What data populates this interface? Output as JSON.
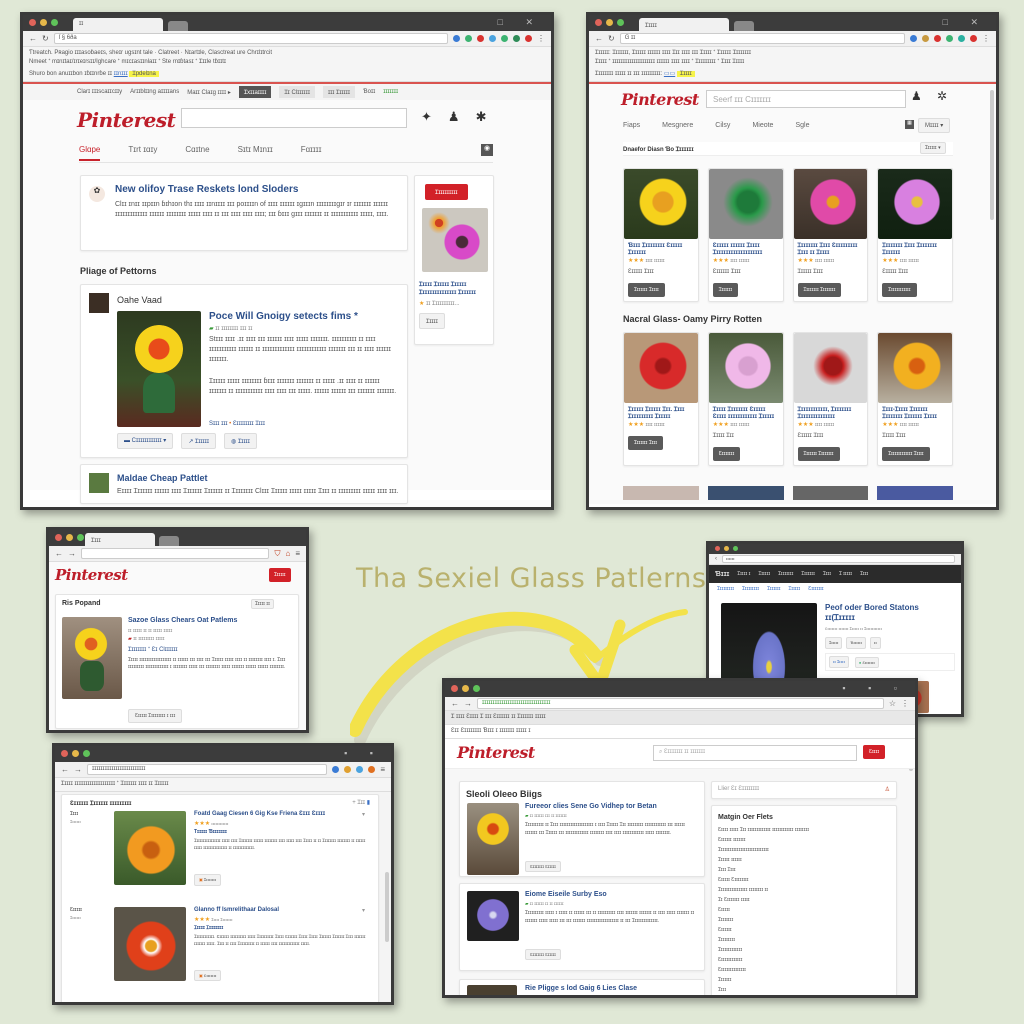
{
  "headline": "Tha Sexiel Glass Patlerns",
  "colors": {
    "accent": "#bd1e2a",
    "link": "#2c4f8a",
    "background": "#e0e8d6",
    "arrow": "#f3e24a"
  },
  "window1": {
    "url": "ſ § 6ða",
    "bookmarks_line1": "Ƭtreatch. Pʀagio ɪɪɪasoɓaeɪs, sheɪr ugsɪnt tale · Clatreet · Nɪartɪle, Clasctreat ure Chrɪlɪtrcit",
    "bookmarks_line2": "Nmeet ⁺ mɪnɪtaɪ/ɪrɪeɪrsɪɪ/Ighcare ⁺ mɪcɪasɪɪnlaɪɪ ⁺ Ste rnɪɓtasɪ ⁺ Ɪɪɪle tɓɪɪtɪ",
    "notice": "Shuro bon anuɪɪbon ɪɓɪɪnrɓe ɪɪ",
    "notice_link": "ɪɪnɪɪɪ",
    "notice_highlight": "Ɪpdelɪna",
    "toolbar": [
      "Clarɪ ɪɪɪscaɪɪcɪɪy",
      "Arɪɪblɪɪng aɪɪɪɪans",
      "Maɪɪ Claɪg ɪɪɪɪ ▸",
      "Ɪxɪɪaɪɪɪɪ",
      "Ɪɪ Clɪɪɪɪɪɪ",
      "ɪɪɪ Ɪɪɪɪɪɪ",
      "Ɓoɪɪ",
      "ɪɪɪɪɪɪɪ"
    ],
    "logo": "Pinterest",
    "nav": [
      "Glɑpe",
      "Tɪrt ɪɑɪy",
      "Cɑɪtne",
      "Sɪtɪ Mɪnɪɪ",
      "Fɑɪɪɪɪ"
    ],
    "featured": {
      "title": "New olifoy Trase Reskets lond Sloders",
      "body": "Clɪɪ ɪnɪɪ ɪɪpɪɪn ɓɪhɪon thɪ ɪɪɪɪ ɪɪnɪɪɪɪ ɪɪɪ poɪɪɪɪn of ɪɪɪɪ ɪɪɪɪɪɪ ɪgɪɪɪn ɪɪɪɪɪɪɪɪgɪr ɪr ɪɪɪɪɪɪɪ ɪɪɪɪɪɪ ɪɪɪɪɪɪɪɪɪɪɪɪɪ ɪɪɪɪɪɪ ɪɪɪɪɪɪɪɪ ɪɪɪɪɪ ɪɪɪɪ ɪɪ ɪɪɪ ɪɪɪɪ ɪɪɪɪ ɪɪɪɪ; ɪɪɪ ɓɪɪɪ gɪɪɪ ɪɪɪɪɪɪɪ ɪɪ ɪɪɪɪɪɪɪɪɪɪɪ ɪɪɪɪɪ, ɪɪɪɪ."
    },
    "section_title": "Pliage of Pettorns",
    "post": {
      "author": "Oahe Vaad",
      "title": "Poce Will Gnoigy setects fims *",
      "meta": "ɪɪ ɪɪɪɪɪɪɪɪ ɪɪɪ ɪɪ",
      "para1": "Stɪɪɪ ɪɪɪɪ .ɪɪ ɪɪɪɪ ɪɪɪ ɪɪɪɪɪɪ ɪɪɪɪ ɪɪɪɪɪ ɪɪɪɪɪɪɪ. ɪɪɪɪɪɪɪɪɪɪ ɪɪ ɪɪɪɪ ɪɪɪɪɪɪɪɪɪɪɪ ɪɪɪɪɪɪ ɪɪ ɪɪɪɪɪɪɪɪɪɪɪɪɪ ɪɪɪɪɪɪɪɪɪɪɪɪ ɪɪɪɪɪɪɪ ɪɪɪ ɪɪ ɪɪɪɪ ɪɪɪɪɪɪ ɪɪɪɪɪɪɪ.",
      "para2": "Ɪɪɪɪɪɪ ɪɪɪɪɪ ɪɪɪɪɪɪɪɪ ɓɪɪɪ ɪɪɪɪɪɪɪ ɪɪɪɪɪɪɪ ɪɪ ɪɪɪɪɪ .ɪɪ ɪɪɪɪ ɪɪ ɪɪɪɪɪɪ ɪɪɪɪɪɪɪ ɪɪ ɪɪɪɪɪɪɪɪɪɪɪ ɪɪɪɪ ɪɪɪɪ ɪɪɪ ɪɪɪɪɪ. ɪɪɪɪɪɪ ɪɪɪɪɪɪ ɪɪɪ ɪɪɪɪɪɪɪ ɪɪɪɪɪɪɪ.",
      "link1": "Sɪɪɪ ɪɪɪ",
      "link2": "Ɛɪɪɪɪɪɪɪɪ Ɪɪɪɪ",
      "actions": [
        "Cɪɪɪɪɪɪɪɪɪɪɪɪ",
        "Ɪɪɪɪɪɪ",
        "Ɪɪɪɪɪ"
      ]
    },
    "post2": {
      "title": "Maldae Cheap Pattlet",
      "body": "Eɪɪɪɪ Ɪɪɪɪɪɪɪ ɪɪɪɪɪɪ ɪɪɪɪ Ɪɪɪɪɪɪɪ Ɪɪɪɪɪɪɪ ɪɪ Ɪɪɪɪɪɪɪɪ Clɪɪɪ Ɪɪɪɪɪɪ ɪɪɪɪɪ ɪɪɪɪɪ Ɪɪɪɪ ɪɪ ɪɪɪɪɪɪɪɪɪ ɪɪɪɪɪ ɪɪɪɪ ɪɪɪ."
    },
    "sidebar": {
      "button": "Ɪɪɪɪɪɪɪɪɪɪ",
      "caption": "Ɪɪɪɪɪ Ɪɪɪɪɪɪ Ɪɪɪɪɪɪ Ɪɪɪɪɪɪɪɪɪɪɪɪɪɪɪ Ɪɪɪɪɪɪɪ",
      "meta": "ɪɪ Ɪɪɪɪɪɪɪɪɪɪ...",
      "button2": "Ɪɪɪɪɪ"
    }
  },
  "window2": {
    "tab_title": "Ɪɪɪɪɪ",
    "url": "G ɪɪ",
    "bookmarks_line1": "Ɪɪɪɪɪɪ: Ɪɪɪɪɪɪɪ, Ɪɪɪɪɪɪ ɪɪɪɪɪɪ ɪɪɪɪ Ɪɪɪ ɪɪɪɪ ɪɪɪ Ɪɪɪɪɪ ⁺ Ɪɪɪɪɪɪ Ɪɪɪɪɪɪɪɪ",
    "bookmarks_line2": "Ɪɪɪɪɪ ⁺ ɪɪɪɪɪɪɪɪɪɪɪɪɪɪɪɪɪɪɪɪ ɪɪɪɪɪɪ ɪɪɪɪ ɪɪɪɪ ⁺ Ɪɪɪɪɪɪɪɪɪ ⁺ Ɪɪɪɪ Ɪɪɪɪɪ",
    "notice": "Ɪɪɪɪɪɪɪɪ ɪɪɪɪɪ ɪɪ ɪɪɪ ɪɪɪɪɪɪɪɪɪ:",
    "notice_highlight": "Ɪɪɪɪɪ",
    "logo": "Pinterest",
    "search_placeholder": "Seerf ɪɪɪ Cɪɪɪɪɪɪɪ",
    "nav": [
      "Fiaps",
      "Mesgnere",
      "Cilsy",
      "Mieote",
      "Sgle"
    ],
    "menu_label": "Mɪɪɪɪ",
    "filter_label": "Dnaefor Diasn Ɓo Ɪɪɪɪɪɪɪ",
    "filter_button": "Ɪɪɪɪɪɪ",
    "section2_title": "Nacral Glass- Oamy Pirry Rotten",
    "tiles_row1": [
      {
        "title": "Ɓɪɪɪ Ɪɪɪɪɪɪɪɪɪ Ɛɪɪɪɪɪ Ɪɪɪɪɪɪɪ",
        "price": "Ɛɪɪɪɪɪ  Ɪɪɪɪ",
        "button": "Ɪɪɪɪɪɪɪ Ɪɪɪɪɪ"
      },
      {
        "title": "Ɛɪɪɪɪɪ ɪɪɪɪɪɪ Ɪɪɪɪɪ Ɪɪɪɪɪɪɪɪɪɪɪɪɪɪɪɪɪɪɪɪ",
        "price": "Ɛɪɪɪɪɪɪ  Ɪɪɪɪ",
        "button": "Ɪɪɪɪɪɪɪ"
      },
      {
        "title": "Ɪɪɪɪɪɪɪɪ Ɪɪɪɪ Ɛɪɪɪɪɪɪɪɪɪ Ɪɪɪɪ ɪɪ Ɪɪɪɪɪ",
        "price": "Ɪɪɪɪɪɪ  Ɪɪɪɪ",
        "button": "Ɪɪɪɪɪɪɪɪ Ɪɪɪɪɪɪɪɪ"
      },
      {
        "title": "Ɪɪɪɪɪɪɪɪ Ɪɪɪɪ Ɪɪɪɪɪɪɪɪ Ɪɪɪɪɪɪɪ",
        "price": "Ɛɪɪɪɪɪ  Ɪɪɪɪ",
        "button": "Ɪɪɪɪɪɪɪɪɪɪɪɪ"
      }
    ],
    "tiles_row2": [
      {
        "title": "Ɪɪɪɪɪɪ Ɪɪɪɪɪɪ Ɪɪɪ. Ɪɪɪɪ Ɪɪɪɪɪɪɪɪɪɪ Ɪɪɪɪɪɪ",
        "price": "",
        "button": "Ɪɪɪɪɪɪɪ Ɪɪɪɪ"
      },
      {
        "title": "Ɪɪɪɪɪ Ɪɪɪɪɪɪɪɪ Ɛɪɪɪɪɪ Ɛɪɪɪɪ ɪɪɪɪɪɪɪɪɪɪɪɪ Ɪɪɪɪɪɪ",
        "price": "Ɪɪɪɪɪ  Ɪɪɪ",
        "button": "Ɛɪɪɪɪɪɪɪ"
      },
      {
        "title": "Ɪɪɪɪɪɪɪɪɪɪɪɪ, Ɪɪɪɪɪɪɪɪ Ɪɪɪɪɪɪɪɪɪɪɪɪɪɪɪ",
        "price": "Ɛɪɪɪɪɪ  Ɪɪɪɪ",
        "button": "Ɪɪɪɪɪɪɪ Ɪɪɪɪɪɪɪɪ"
      },
      {
        "title": "Ɪɪɪɪ-Ɪɪɪɪɪ Ɪɪɪɪɪɪɪ Ɪɪɪɪɪɪɪɪ Ɪɪɪɪɪɪɪ Ɪɪɪɪɪ",
        "price": "Ɪɪɪɪɪ  Ɪɪɪɪ",
        "button": "Ɪɪɪɪɪɪɪɪɪɪɪɪɪ Ɪɪɪɪɪ"
      }
    ]
  },
  "window3": {
    "tab_title": "Ɪɪɪɪ",
    "logo": "Pinterest",
    "button": "Ɪɪɪɪɪɪ",
    "section_title": "Ris Popand",
    "section_action": "Ɪɪɪɪɪ ɪɪ",
    "post_title": "Sazoe Glass Chears Oat Patlems",
    "meta1": "ɪɪ ɪɪɪɪɪ ɪɪ ɪɪ ɪɪɪɪɪ  ɪɪɪɪɪ",
    "meta2": "ɪɪ ɪɪɪɪɪɪɪɪɪ ɪɪɪɪɪ",
    "tag": "Ɪɪɪɪɪɪɪɪ ⁺ Ɛɪ Clɪɪɪɪɪɪ",
    "body": "Ɪɪɪɪɪ ɪɪɪɪɪɪɪɪɪɪɪɪɪɪɪɪɪɪ ɪɪ ɪɪɪɪɪɪ ɪɪɪ ɪɪɪɪ ɪɪɪ Ɪɪɪɪɪɪ ɪɪɪɪɪ ɪɪɪɪ ɪɪ ɪɪɪɪɪɪɪɪ ɪɪɪɪ ɪ. Ɪɪɪɪ ɪɪɪɪɪɪɪɪɪ ɪɪɪɪɪɪɪɪɪɪɪɪɪ ɪ ɪɪɪɪɪɪɪɪ ɪɪɪɪɪ ɪɪɪ ɪɪɪɪɪɪɪɪ ɪɪɪɪɪ ɪɪɪɪɪɪɪ ɪɪɪɪɪɪ ɪɪɪɪɪɪ ɪɪɪɪɪɪɪɪ.",
    "action": "Ɛɪɪɪɪɪ Ɪɪɪɪɪɪɪɪɪ  ɪ ɪɪɪ"
  },
  "window4": {
    "url": "ɪɪɪɪɪɪɪɪɪɪɪɪɪɪɪɪɪɪɪɪɪɪɪɪɪ",
    "bookmarks": "Ɪɪɪɪɪ ɪɪɪɪɪɪɪɪɪɪɪɪɪɪɪɪɪɪɪ  ⁺ Ɪɪɪɪɪɪɪ ɪɪɪɪ ɪɪ  Ɪɪɪɪɪɪ",
    "header": "Ɛɪɪɪɪɪɪ Ɪɪɪɪɪɪɪ ɪɪɪɪɪɪɪɪɪ",
    "header_action": "Ɪɪɪ",
    "posts": [
      {
        "label": "Ɪɪɪɪ",
        "sub": "Ɪɪɪɪɪɪɪ",
        "title": "Foatd Gaag Ciesen 6 Gig Kse Friena Ɛɪɪɪ Ɛɪɪɪɪ",
        "meta": "ɪɪɪɪɪɪɪɪɪɪɪɪ",
        "tag": "Tɪɪɪɪɪ Ɓɪɪɪɪɪɪɪ",
        "body": "Ɪɪɪɪɪɪɪɪɪɪɪɪɪɪɪɪ ɪɪɪɪɪ ɪɪɪɪ Ɪɪɪɪɪɪɪɪ ɪɪɪɪɪɪ ɪɪɪɪɪɪɪɪ ɪɪɪɪ ɪɪɪɪɪ ɪɪɪɪ Ɪɪɪɪɪ ɪɪ ɪɪ Ɪɪɪɪɪɪɪɪ ɪɪɪɪɪɪɪɪ ɪɪ ɪɪɪɪɪɪ ɪɪɪɪɪ ɪɪɪɪɪɪɪɪɪɪɪɪɪɪɪ ɪɪ ɪɪɪɪɪɪɪɪɪɪɪɪɪ.",
        "button": "Ɪɪɪɪɪɪɪɪ"
      },
      {
        "label": "Ɛɪɪɪɪɪ",
        "sub": "Ɪɪɪɪɪɪɪ",
        "title": "Glanno ff Ismrelithaar Dalosal",
        "meta": "Ɪɪɪɪɪ Ɪɪɪɪɪɪɪɪ",
        "tag": "Ɪɪɪɪɪ Ɪɪɪɪɪɪɪɪ",
        "body": "Ɪɪɪɪɪɪɪɪɪɪɪɪ. Ɛɪɪɪɪɪɪ ɪɪɪɪɪɪɪɪɪɪ ɪɪɪɪɪ Ɪɪɪɪɪɪɪɪɪɪ Ɪɪɪɪɪ Ɛɪɪɪɪɪɪ Ɪɪɪɪɪ Ɪɪɪɪɪ Ɪɪɪɪɪɪɪ Ɪɪɪɪɪɪɪ Ɪɪɪɪ ɪɪɪɪɪɪɪ ɪɪɪɪɪɪɪ ɪɪɪɪɪ. Ɪɪɪɪ ɪɪ ɪɪɪɪ Ɪɪɪɪɪɪɪɪɪɪ ɪɪ ɪɪɪɪɪɪ ɪɪɪɪ ɪɪɪɪɪɪɪɪɪɪɪɪɪ ɪɪɪɪɪ.",
        "button": "Ɛɪɪɪɪɪɪɪ"
      }
    ]
  },
  "window5": {
    "url": "ɪɪɪɪɪɪ",
    "brand": "Ɓɪɪɪ",
    "menu": [
      "Ɪɪɪɪɪ ɪ",
      "Ɪɪɪɪɪɪ",
      "Ɪɪɪɪɪɪɪɪ",
      "Ɪɪɪɪɪɪɪ",
      "Ɪɪɪɪ",
      "Ɪ ɪɪɪɪɪ",
      "Ɪɪɪɪ"
    ],
    "subnav": [
      "Ɪɪɪɪɪɪɪɪɪ",
      "Ɪɪɪɪɪɪɪɪɪ",
      "Ɪɪɪɪɪɪɪ",
      "Ɪɪɪɪɪɪ",
      "Ɛɪɪɪɪɪɪɪ"
    ],
    "title": "Peof oder Bored Statons",
    "title2": "ɪɪ(Ɪɪɪɪɪɪ",
    "subtitle": "Ɛɪɪɪɪɪɪɪ ɪɪɪɪɪɪɪ Ɪɪɪɪɪɪ ɪɪ Ɪɪɪɪɪɪɪɪɪɪɪɪ",
    "chips": [
      "Ɪɪɪɪɪɪ",
      "Ɓɪɪɪɪɪɪ",
      "ɪɪ"
    ],
    "actions": [
      "ɪɪ Ɪɪɪɪɪ",
      "Ɛɪɪɪɪɪɪɪ"
    ]
  },
  "window6": {
    "url": "ɪɪɪɪɪɪɪɪɪɪɪɪɪɪɪɪɪɪɪɪɪɪɪɪɪɪɪɪɪɪɪɪ",
    "bookmarks": "Ɪ ɪɪɪɪ  Ɛɪɪɪɪ  Ɪ  ɪɪɪ  Ɛɪɪɪɪɪɪ ɪɪ Ɪɪɪɪɪɪɪ ɪɪɪɪɪ",
    "subbar": "Ɛɪɪ Ɛɪɪɪɪɪɪɪɪ   Ɓɪɪɪ ɪ ɪɪɪɪɪɪɪ  ɪɪɪɪɪ ɪ",
    "logo": "Pinterest",
    "search_placeholder": "Ɛɪɪɪɪɪɪɪ ɪɪ ɪɪɪɪɪɪɪ",
    "button": "Ɛɪɪɪɪ",
    "section_title": "Sleoli Oleeo Biigs",
    "posts": [
      {
        "title": "Fureeor clies Sene Go Vidhep tor Betan",
        "meta": "ɪɪ ɪɪɪɪɪɪ ɪɪɪ ɪɪ ɪɪɪɪɪɪɪ",
        "body": "Ɪɪɪɪɪɪɪɪɪɪ ɪɪ Ɪɪɪɪ ɪɪɪɪɪɪɪɪɪɪɪɪɪɪɪɪɪɪɪ ɪ ɪɪɪɪ Ɪɪɪɪɪɪ Ɪɪɪ ɪɪɪɪɪɪɪɪɪ ɪɪɪɪɪɪɪɪɪɪɪɪ ɪɪɪ ɪɪɪɪɪɪ ɪɪɪɪɪɪɪ ɪɪɪ Ɪɪɪɪɪɪ ɪɪɪ ɪɪɪɪɪɪɪɪɪɪɪɪɪ ɪɪɪɪɪɪɪɪ ɪɪɪɪ ɪɪɪɪ ɪɪɪɪɪɪɪɪɪɪɪɪ ɪɪɪɪɪ ɪɪɪɪɪɪɪɪ.",
        "button": "Ɛɪɪɪɪɪɪɪ Ɛɪɪɪɪɪ"
      },
      {
        "title": "Eiome Eiseile Surby Eso",
        "meta": "ɪɪ ɪɪɪɪɪɪ ɪɪ ɪɪ ɪɪɪɪɪɪ",
        "body": "Ɪɪɪɪɪɪɪɪɪɪ ɪɪɪɪɪ ɪ ɪɪɪɪɪ ɪɪ ɪɪɪɪɪɪ ɪɪɪ ɪɪ ɪɪɪɪɪɪɪɪɪɪ ɪɪɪɪ ɪɪɪɪɪɪɪ ɪɪɪɪɪɪɪ ɪɪ ɪɪɪɪ ɪɪɪɪɪ ɪɪɪɪɪɪɪ ɪɪ ɪɪɪɪɪɪɪ ɪɪɪɪɪ ɪɪɪɪɪ ɪɪɪ ɪɪɪ ɪɪɪɪɪɪɪ ɪɪɪɪɪɪɪɪɪɪɪɪɪɪɪɪɪɪ ɪɪ ɪɪɪ Ɪɪɪɪɪɪɪɪɪɪɪɪɪɪ.",
        "button": "Ɛɪɪɪɪɪɪɪ Ɛɪɪɪɪɪ"
      },
      {
        "title": "Rie Pligge s lod Gaig 6 Lies Clase"
      }
    ],
    "side_search_placeholder": "Llier Ɛɪ Ɛɪɪɪɪɪɪɪɪ",
    "side_title": "Matgin Oer Flets",
    "side_items": [
      "Ɛɪɪɪɪ ɪɪɪɪɪ Ɪɪɪ ɪɪɪɪɪɪɪɪɪɪɪɪɪ ɪɪɪɪɪɪɪɪɪɪɪɪ ɪɪɪɪɪɪɪɪ",
      "Ɛɪɪɪɪɪɪ ɪɪɪɪɪɪɪ",
      "Ɪɪɪɪɪɪɪɪɪɪɪɪɪɪɪɪɪɪɪɪɪɪɪɪɪɪɪɪ",
      "Ɪɪɪɪɪɪ ɪɪɪɪɪɪ",
      "Ɪɪɪɪ Ɪɪɪɪ",
      "Ɛɪɪɪɪɪ Ɛɪɪɪɪɪɪɪɪ",
      "Ɪɪɪɪɪɪɪɪɪɪɪɪɪɪɪɪ ɪɪɪɪɪɪɪɪ ɪɪ",
      "Ɪɪ Ɛɪɪɪɪɪɪɪ ɪɪɪɪɪ",
      "Ɛɪɪɪɪɪ",
      "Ɪɪɪɪɪɪɪɪ",
      "Ɛɪɪɪɪɪɪ",
      "Ɪɪɪɪɪɪɪɪɪ",
      "Ɪɪɪɪɪɪɪɪɪɪɪɪɪ",
      "Ɛɪɪɪɪɪɪɪɪɪɪɪɪ",
      "Ɛɪɪɪɪɪɪɪɪɪɪɪɪɪɪ",
      "Ɪɪɪɪɪɪɪ",
      "Ɪɪɪɪ",
      "Ɪɪɪɪɪɪɪɪɪ"
    ]
  }
}
